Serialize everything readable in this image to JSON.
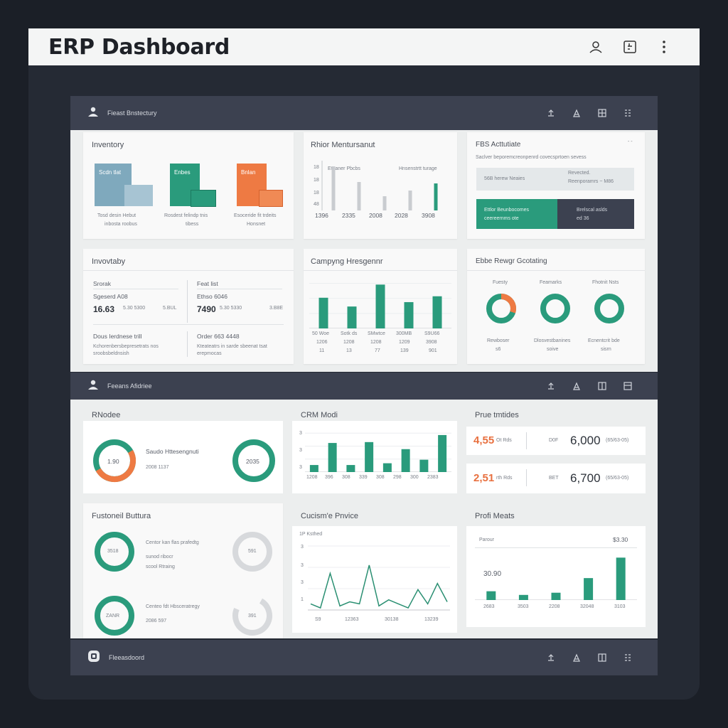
{
  "header": {
    "title": "ERP Dashboard",
    "icons": [
      "user-icon",
      "calendar-icon",
      "more-vertical-icon"
    ]
  },
  "section1": {
    "label": "Fieast Bnstectury"
  },
  "section2": {
    "label": "Feeans Afidriee"
  },
  "footer": {
    "label": "Fleeasdoord"
  },
  "inventory": {
    "title": "Inventory",
    "tiles": [
      {
        "label": "Scdn tlat",
        "color": "#7fa9bd",
        "caption1": "Tosd desin Hebut",
        "caption2": "inbosta roobus"
      },
      {
        "label": "Enbes",
        "color": "#2a9b7c",
        "caption1": "Rosdest felindp tnis",
        "caption2": "tibess"
      },
      {
        "label": "Bnlan",
        "color": "#ee7a43",
        "caption1": "Esoceride fit trdeits",
        "caption2": "Honsnet"
      }
    ]
  },
  "rnior": {
    "title": "Rhior Mentursanut",
    "sub1": "Eteaner Pbcbs",
    "sub2": "Hnsenstrtt turage",
    "yticks": [
      "18",
      "18",
      "18",
      "48"
    ],
    "xticks": [
      "1396",
      "2335",
      "2008",
      "2028",
      "3908"
    ]
  },
  "fbs": {
    "title": "FBS Acttutiate",
    "dash": "- -",
    "subtitle": "Saclver beporemcreonpenrd covecsprtoen sevess",
    "row1_left": "56B herew Neaies",
    "row1_right1": "Revected.",
    "row1_right2": "Reenporamrs ~ M86",
    "row2_left1": "Ettlor Beunbocomes",
    "row2_left2": "ceereernms ote",
    "row2_right1": "Brelscal  aslds",
    "row2_right2": "ed 36"
  },
  "inventory2": {
    "title": "Invovtaby",
    "left": {
      "label": "Srorak",
      "sub": "Sgeserd A08",
      "value": "16.63",
      "unit": "5.30 5300",
      "suffix": "5.BUL"
    },
    "right": {
      "label": "Feat list",
      "sub": "Ethso 6046",
      "value": "7490",
      "unit": "5.30 5330",
      "suffix": "3.B8E"
    },
    "bottom_left": {
      "label": "Dous Ierdnese trill",
      "desc1": "Kchorenbersbepresetrats nos",
      "desc2": "sroobsbeldnsish"
    },
    "bottom_right": {
      "label": "Order 663 4448",
      "desc1": "Kteateatrs in sarde sbeenat tsat",
      "desc2": "erepmocas"
    }
  },
  "campaign": {
    "title": "Campyng Hresgennr",
    "labels": [
      {
        "a": "50 Woe",
        "b": "1206",
        "c": "11"
      },
      {
        "a": "Sotk ds",
        "b": "1208",
        "c": "13"
      },
      {
        "a": "SMwtce",
        "b": "1208",
        "c": "77"
      },
      {
        "a": "300MB",
        "b": "1209",
        "c": "139"
      },
      {
        "a": "S9U66",
        "b": "3908",
        "c": "901"
      }
    ]
  },
  "rings": {
    "title": "Ebbe Rewgr Gcotating",
    "items": [
      {
        "top": "Fuesty",
        "bottom1": "Rewboser",
        "bottom2": "s6"
      },
      {
        "top": "Feamarks",
        "bottom1": "Dlosvestbanines",
        "bottom2": "soive"
      },
      {
        "top": "Fhotnit Nsts",
        "bottom1": "Ecnentcrit bde",
        "bottom2": "sisrn"
      }
    ]
  },
  "rnodee": {
    "title": "RNodee",
    "left_value": "1.90",
    "heading": "Saudo Httesengnuti",
    "sub": "2008 1137",
    "right_value": "2035"
  },
  "crm": {
    "title": "CRM Modi",
    "yticks": [
      "3",
      "3",
      "3"
    ],
    "xticks": [
      "1208",
      "396",
      "308",
      "339",
      "308",
      "298",
      "300",
      "2383"
    ]
  },
  "prue": {
    "title": "Prue tmtides",
    "row1": {
      "left": "4,55",
      "left_sub": "Ot Rds",
      "mid": "D0F",
      "right": "6,000",
      "right_sub": "(65/63-05)"
    },
    "row2": {
      "left": "2,51",
      "left_sub": "rth Rds",
      "mid": "BET",
      "right": "6,700",
      "right_sub": "(65/63-05)"
    }
  },
  "customer": {
    "title": "Fustoneil Buttura",
    "r1_value": "3518",
    "r1_line1": "Centor kan flas prafedtg",
    "r1_line2": "sunod ribocr",
    "r1_line3": "scool Rtraing",
    "r1_right": "591",
    "r2_value": "ZANR",
    "r2_line1": "Centeo fdt Hbsceratregy",
    "r2_line2": "2086  597",
    "r2_right": "391"
  },
  "price": {
    "title": "Cucism'e Pnvice",
    "sub": "1P Ksthed",
    "yticks": [
      "3",
      "3",
      "3",
      "1"
    ],
    "xticks": [
      "S9",
      "12363",
      "30138",
      "13239"
    ]
  },
  "profit": {
    "title": "Profi Meats",
    "left": "Parour",
    "right": "$3.30",
    "value": "30.90",
    "xticks": [
      "2683",
      "3503",
      "2208",
      "32048",
      "3103"
    ]
  },
  "chart_data": [
    {
      "type": "bar",
      "title": "Campyng Hresgennr",
      "categories": [
        "50 Woe",
        "Sotk ds",
        "SMwtce",
        "300MB",
        "S9U66"
      ],
      "values": [
        42,
        30,
        60,
        36,
        44
      ],
      "ylim": [
        0,
        70
      ]
    },
    {
      "type": "bar",
      "title": "CRM Modi",
      "categories": [
        "1208",
        "396",
        "308",
        "339",
        "308",
        "298",
        "300",
        "2383"
      ],
      "values": [
        8,
        33,
        8,
        34,
        10,
        26,
        14,
        42
      ],
      "ylim": [
        0,
        50
      ]
    },
    {
      "type": "line",
      "title": "Cucism'e Pnvice",
      "x": [
        0,
        1,
        2,
        3,
        4,
        5,
        6,
        7,
        8,
        9,
        10,
        11,
        12,
        13,
        14
      ],
      "values": [
        3,
        1,
        18,
        2,
        4,
        3,
        22,
        2,
        5,
        3,
        1,
        10,
        3,
        13,
        4
      ],
      "ylim": [
        0,
        30
      ]
    },
    {
      "type": "bar",
      "title": "Profi Meats",
      "categories": [
        "2683",
        "3503",
        "2208",
        "32048",
        "3103"
      ],
      "values": [
        12,
        7,
        10,
        30,
        58
      ],
      "ylim": [
        0,
        70
      ]
    },
    {
      "type": "bar",
      "title": "Rhior Mentursanut",
      "categories": [
        "1396",
        "2335",
        "2008",
        "2028",
        "3908"
      ],
      "values": [
        62,
        40,
        20,
        28,
        38
      ],
      "colors": [
        "#c9ccd0",
        "#c9ccd0",
        "#c9ccd0",
        "#c9ccd0",
        "#2a9b7c"
      ],
      "ylim": [
        0,
        70
      ]
    }
  ],
  "colors": {
    "green": "#2a9b7c",
    "orange": "#ee7a43",
    "navy": "#3c4150",
    "grey": "#c9ccd0"
  }
}
